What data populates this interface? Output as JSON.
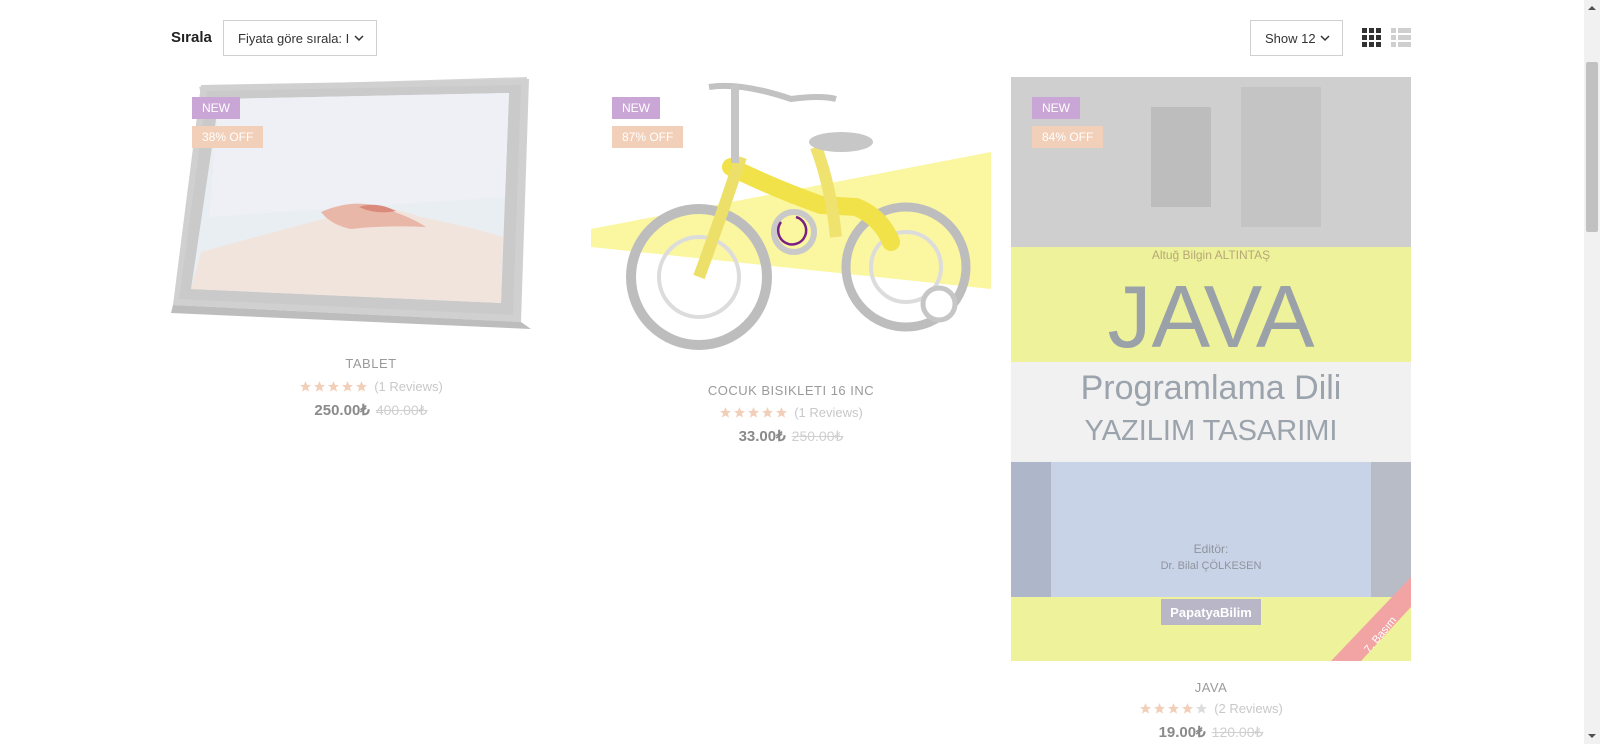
{
  "toolbar": {
    "sort_label": "Sırala",
    "sort_value": "Fiyata göre sırala: I",
    "show_value": "Show 12"
  },
  "products": [
    {
      "badge_new": "NEW",
      "badge_off": "38% OFF",
      "title": "TABLET",
      "reviews": "(1 Reviews)",
      "rating": 5,
      "price": "250.00₺",
      "old_price": "400.00₺"
    },
    {
      "badge_new": "NEW",
      "badge_off": "87% OFF",
      "title": "COCUK BISIKLETI 16 INC",
      "reviews": "(1 Reviews)",
      "rating": 5,
      "price": "33.00₺",
      "old_price": "250.00₺"
    },
    {
      "badge_new": "NEW",
      "badge_off": "84% OFF",
      "title": "JAVA",
      "reviews": "(2 Reviews)",
      "rating": 4,
      "price": "19.00₺",
      "old_price": "120.00₺"
    }
  ],
  "book_cover": {
    "author": "Altuğ Bilgin ALTINTAŞ",
    "title": "JAVA",
    "subtitle1": "Programlama Dili",
    "subtitle2": "YAZILIM TASARIMI",
    "editor_label": "Editör:",
    "editor_name": "Dr. Bilal ÇÖLKESEN",
    "publisher": "PapatyaBilim",
    "edition": "7. Basım"
  },
  "colors": {
    "badge_new": "#caa6d6",
    "badge_off": "#f2cfb9",
    "star_filled": "#f2cfb9",
    "star_empty": "#dddddd"
  }
}
